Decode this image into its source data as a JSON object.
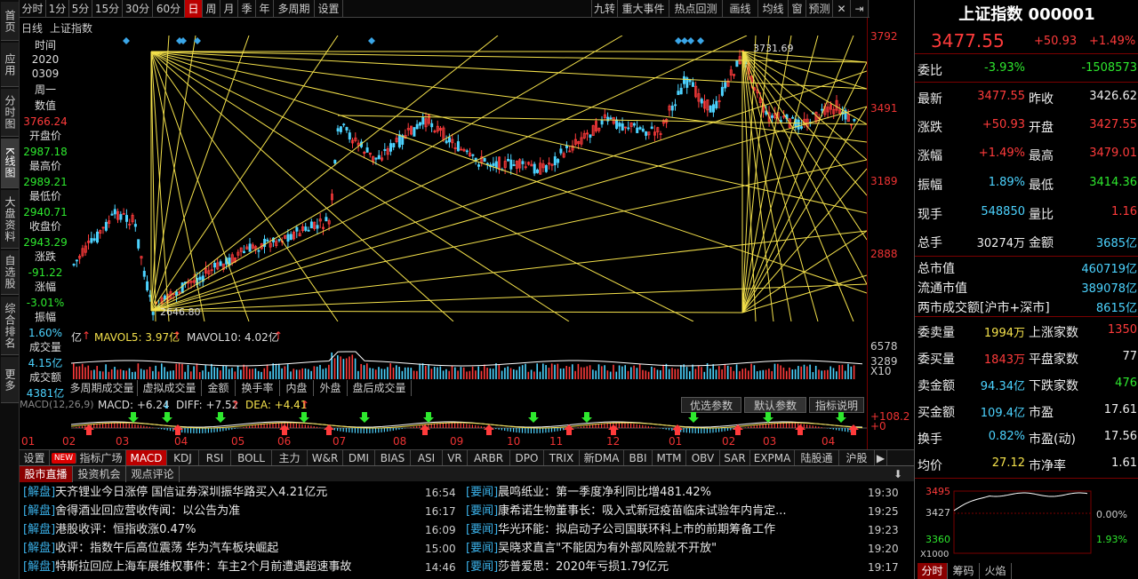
{
  "left_tabs": [
    "首页",
    "应用",
    "分时图",
    "K线图",
    "大盘资料",
    "自选股",
    "综合排名",
    "更多"
  ],
  "periods": [
    "分时",
    "1分",
    "5分",
    "15分",
    "30分",
    "60分",
    "日",
    "周",
    "月",
    "季",
    "年",
    "多周期",
    "设置"
  ],
  "active_period": "日",
  "tools": [
    "九转",
    "重大事件",
    "热点回测",
    "画线",
    "均线",
    "窗",
    "预测"
  ],
  "tool_icons": [
    "close-icon",
    "back-arrow-icon"
  ],
  "subtitle": {
    "period": "日线",
    "name": "上证指数"
  },
  "info": {
    "time_label": "时间",
    "date1": "2020",
    "date2": "0309",
    "weekday": "周一",
    "val_label": "数值",
    "val": "3766.24",
    "open_label": "开盘价",
    "open": "2987.18",
    "high_label": "最高价",
    "high": "2989.21",
    "low_label": "最低价",
    "low": "2940.71",
    "close_label": "收盘价",
    "close": "2943.29",
    "chg_label": "涨跌",
    "chg": "-91.22",
    "pct_label": "涨幅",
    "pct": "-3.01%",
    "amp_label": "振幅",
    "amp": "1.60%",
    "vol_label": "成交量",
    "vol": "4.15亿",
    "amt_label": "成交额",
    "amt": "4381亿"
  },
  "price_axis": [
    "3792",
    "3491",
    "3189",
    "2888"
  ],
  "annotations": {
    "high": "3731.69",
    "low": "2646.80"
  },
  "volume_bar": {
    "item1": "亿",
    "mavol5": "MAVOL5: 3.97亿",
    "mavol10": "MAVOL10: 4.02亿"
  },
  "volume_axis": [
    "6578",
    "3289",
    "X10"
  ],
  "mid_tabs": [
    "多周期成交量",
    "虚拟成交量",
    "金额",
    "换手率",
    "内盘",
    "外盘",
    "盘后成交量"
  ],
  "macd_bar": {
    "label": "MACD(12,26,9)",
    "macd": "MACD: +6.24",
    "diff": "DIFF: +7.52",
    "dea": "DEA: +4.41"
  },
  "param_buttons": [
    "优选参数",
    "默认参数",
    "指标说明"
  ],
  "macd_axis": [
    "+108.2",
    "+0"
  ],
  "months": [
    "01",
    "02",
    "03",
    "04",
    "05",
    "06",
    "07",
    "08",
    "09",
    "10",
    "11",
    "12",
    "01",
    "02",
    "03",
    "04"
  ],
  "indicator_tabs": [
    "设置",
    "NEW",
    "指标广场",
    "MACD",
    "KDJ",
    "RSI",
    "BOLL",
    "主力",
    "W&R",
    "DMI",
    "BIAS",
    "ASI",
    "VR",
    "ARBR",
    "DPO",
    "TRIX",
    "新DMA",
    "BBI",
    "MTM",
    "OBV",
    "SAR",
    "EXPMA",
    "陆股通",
    "沪股"
  ],
  "news_tabs": [
    "股市直播",
    "投资机会",
    "观点评论"
  ],
  "news_left": [
    {
      "cat": "[解盘]",
      "title": "天齐锂业今日涨停 国信证券深圳振华路买入4.21亿元",
      "time": "16:54"
    },
    {
      "cat": "[解盘]",
      "title": "舍得酒业回应营收传闻：以公告为准",
      "time": "16:17"
    },
    {
      "cat": "[解盘]",
      "title": "港股收评：恒指收涨0.47%",
      "time": "16:09"
    },
    {
      "cat": "[解盘]",
      "title": "收评：指数午后高位震荡 华为汽车板块崛起",
      "time": "15:00"
    },
    {
      "cat": "[解盘]",
      "title": "特斯拉回应上海车展维权事件：车主2个月前遭遇超速事故",
      "time": "14:46"
    }
  ],
  "news_right": [
    {
      "cat": "[要闻]",
      "title": "晨鸣纸业：第一季度净利同比增481.42%",
      "time": "19:30"
    },
    {
      "cat": "[要闻]",
      "title": "康希诺生物董事长：吸入式新冠疫苗临床试验年内肯定...",
      "time": "19:25"
    },
    {
      "cat": "[要闻]",
      "title": "华光环能：拟启动子公司国联环科上市的前期筹备工作",
      "time": "19:23"
    },
    {
      "cat": "[要闻]",
      "title": "吴晓求直言\"不能因为有外部风险就不开放\"",
      "time": "19:20"
    },
    {
      "cat": "[要闻]",
      "title": "莎普爱思：2020年亏损1.79亿元",
      "time": "19:17"
    }
  ],
  "quote": {
    "title": "上证指数 000001",
    "price": "3477.55",
    "change": "+50.93",
    "pct": "+1.49%"
  },
  "quote_rows": [
    {
      "l1": "委比",
      "v1": "-3.93%",
      "c1": "green",
      "l2": "",
      "v2": "-1508573",
      "c2": "green"
    },
    {
      "l1": "最新",
      "v1": "3477.55",
      "c1": "red",
      "l2": "昨收",
      "v2": "3426.62",
      "c2": "white"
    },
    {
      "l1": "涨跌",
      "v1": "+50.93",
      "c1": "red",
      "l2": "开盘",
      "v2": "3427.55",
      "c2": "red"
    },
    {
      "l1": "涨幅",
      "v1": "+1.49%",
      "c1": "red",
      "l2": "最高",
      "v2": "3479.01",
      "c2": "red"
    },
    {
      "l1": "振幅",
      "v1": "1.89%",
      "c1": "cyan",
      "l2": "最低",
      "v2": "3414.36",
      "c2": "green"
    },
    {
      "l1": "现手",
      "v1": "548850",
      "c1": "cyan",
      "l2": "量比",
      "v2": "1.16",
      "c2": "red"
    },
    {
      "l1": "总手",
      "v1": "30274万",
      "c1": "white",
      "l2": "金额",
      "v2": "3685亿",
      "c2": "cyan"
    }
  ],
  "market": [
    {
      "l": "总市值",
      "v": "460719亿"
    },
    {
      "l": "流通市值",
      "v": "389078亿"
    },
    {
      "l": "两市成交额[沪市+深市]",
      "v": "8615亿"
    }
  ],
  "orders": [
    {
      "l1": "委卖量",
      "v1": "1994万",
      "c1": "yellow",
      "l2": "上涨家数",
      "v2": "1350",
      "c2": "red"
    },
    {
      "l1": "委买量",
      "v1": "1843万",
      "c1": "red",
      "l2": "平盘家数",
      "v2": "77",
      "c2": "white"
    },
    {
      "l1": "卖金额",
      "v1": "94.34亿",
      "c1": "cyan",
      "l2": "下跌家数",
      "v2": "476",
      "c2": "green"
    },
    {
      "l1": "买金额",
      "v1": "109.4亿",
      "c1": "cyan",
      "l2": "市盈",
      "v2": "17.61",
      "c2": "white"
    },
    {
      "l1": "换手",
      "v1": "0.82%",
      "c1": "cyan",
      "l2": "市盈(动)",
      "v2": "17.56",
      "c2": "white"
    },
    {
      "l1": "均价",
      "v1": "27.12",
      "c1": "yellow",
      "l2": "市净率",
      "v2": "1.61",
      "c2": "white"
    }
  ],
  "mini": {
    "y1": "3495",
    "y2": "3427",
    "y3": "3360",
    "pct1": "0.00%",
    "pct2": "1.93%",
    "x10": "X1000"
  },
  "right_bottom_tabs": [
    "分时",
    "筹码",
    "火焰"
  ],
  "colors": {
    "up": "#ff3b3b",
    "down": "#4cd3ff",
    "draw_line": "#f4e14b",
    "axis": "#8a0000"
  }
}
